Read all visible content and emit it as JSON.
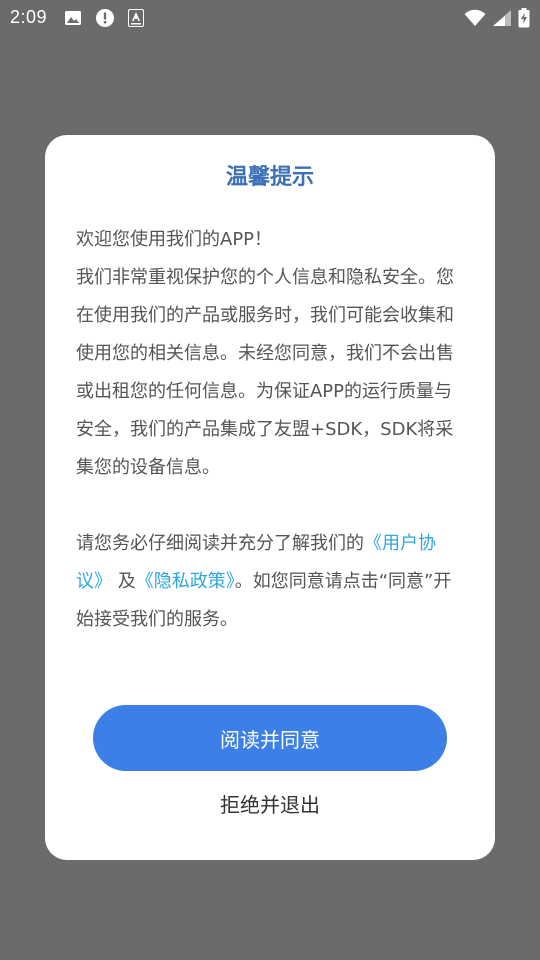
{
  "status_bar": {
    "time": "2:09",
    "icons_left": [
      "image-icon",
      "alert-icon",
      "font-a-icon"
    ],
    "icons_right": [
      "wifi-icon",
      "signal-icon",
      "battery-charging-icon"
    ]
  },
  "dialog": {
    "title": "温馨提示",
    "paragraph1_line1": "欢迎您使用我们的APP！",
    "paragraph1_rest": "我们非常重视保护您的个人信息和隐私安全。您在使用我们的产品或服务时，我们可能会收集和使用您的相关信息。未经您同意，我们不会出售或出租您的任何信息。为保证APP的运行质量与安全，我们的产品集成了友盟+SDK，SDK将采集您的设备信息。",
    "paragraph2_prefix": "请您务必仔细阅读并充分了解我们的",
    "user_agreement_link": "《用户协议》",
    "paragraph2_and": "及",
    "privacy_policy_link": "《隐私政策》",
    "paragraph2_suffix": "。如您同意请点击“同意”开始接受我们的服务。",
    "agree_button_label": "阅读并同意",
    "reject_button_label": "拒绝并退出"
  },
  "colors": {
    "overlay": "#6b6b6b",
    "title": "#3b6fb6",
    "link": "#2ea7e0",
    "primary_button": "#3c7fe6"
  }
}
